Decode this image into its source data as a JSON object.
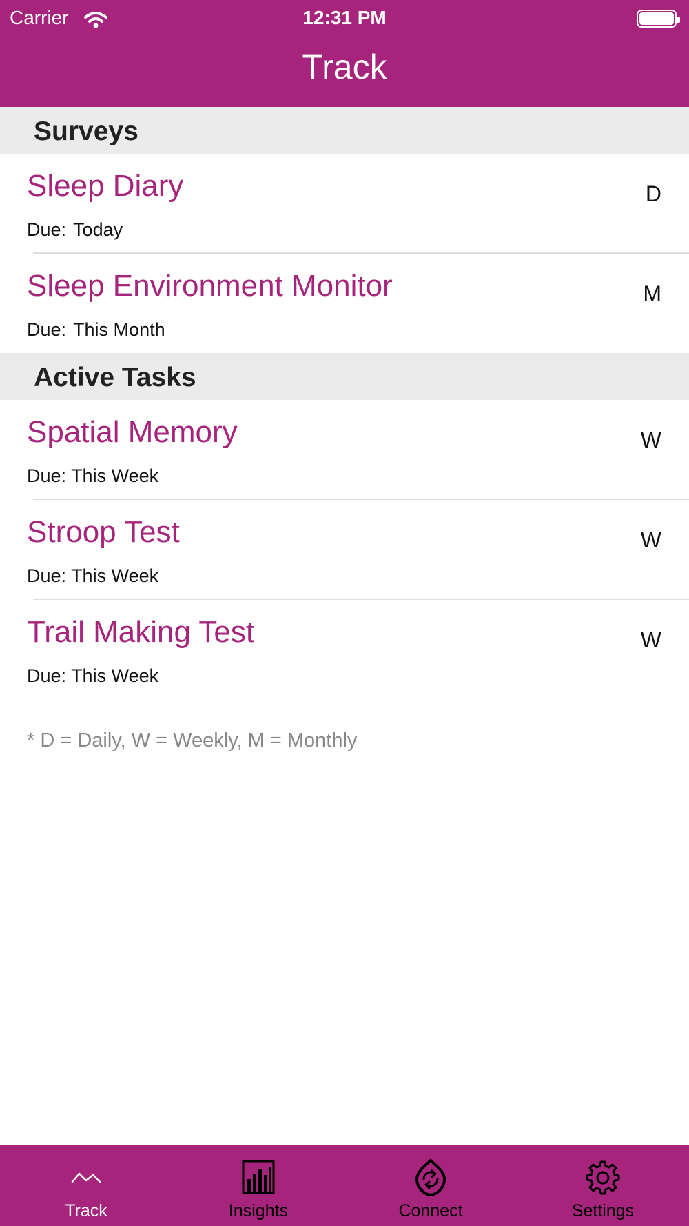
{
  "status_bar": {
    "carrier": "Carrier",
    "time": "12:31 PM"
  },
  "nav": {
    "title": "Track"
  },
  "sections": [
    {
      "header": "Surveys",
      "items": [
        {
          "title": "Sleep Diary",
          "due_label": "Due:",
          "due_value": "Today",
          "frequency": "D"
        },
        {
          "title": "Sleep Environment Monitor",
          "due_label": "Due:",
          "due_value": "This Month",
          "frequency": "M"
        }
      ]
    },
    {
      "header": "Active Tasks",
      "items": [
        {
          "title": "Spatial Memory",
          "due_label": "Due:",
          "due_value": "This Week",
          "frequency": "W"
        },
        {
          "title": "Stroop Test",
          "due_label": "Due:",
          "due_value": "This Week",
          "frequency": "W"
        },
        {
          "title": "Trail Making Test",
          "due_label": "Due:",
          "due_value": "This Week",
          "frequency": "W"
        }
      ]
    }
  ],
  "legend": "* D = Daily, W = Weekly, M = Monthly",
  "tabbar": {
    "tabs": [
      {
        "label": "Track",
        "icon": "track-icon",
        "active": true
      },
      {
        "label": "Insights",
        "icon": "insights-icon",
        "active": false
      },
      {
        "label": "Connect",
        "icon": "connect-icon",
        "active": false
      },
      {
        "label": "Settings",
        "icon": "settings-icon",
        "active": false
      }
    ]
  },
  "colors": {
    "brand": "#a6247c",
    "section_bg": "#ebebeb",
    "legend": "#888888"
  }
}
